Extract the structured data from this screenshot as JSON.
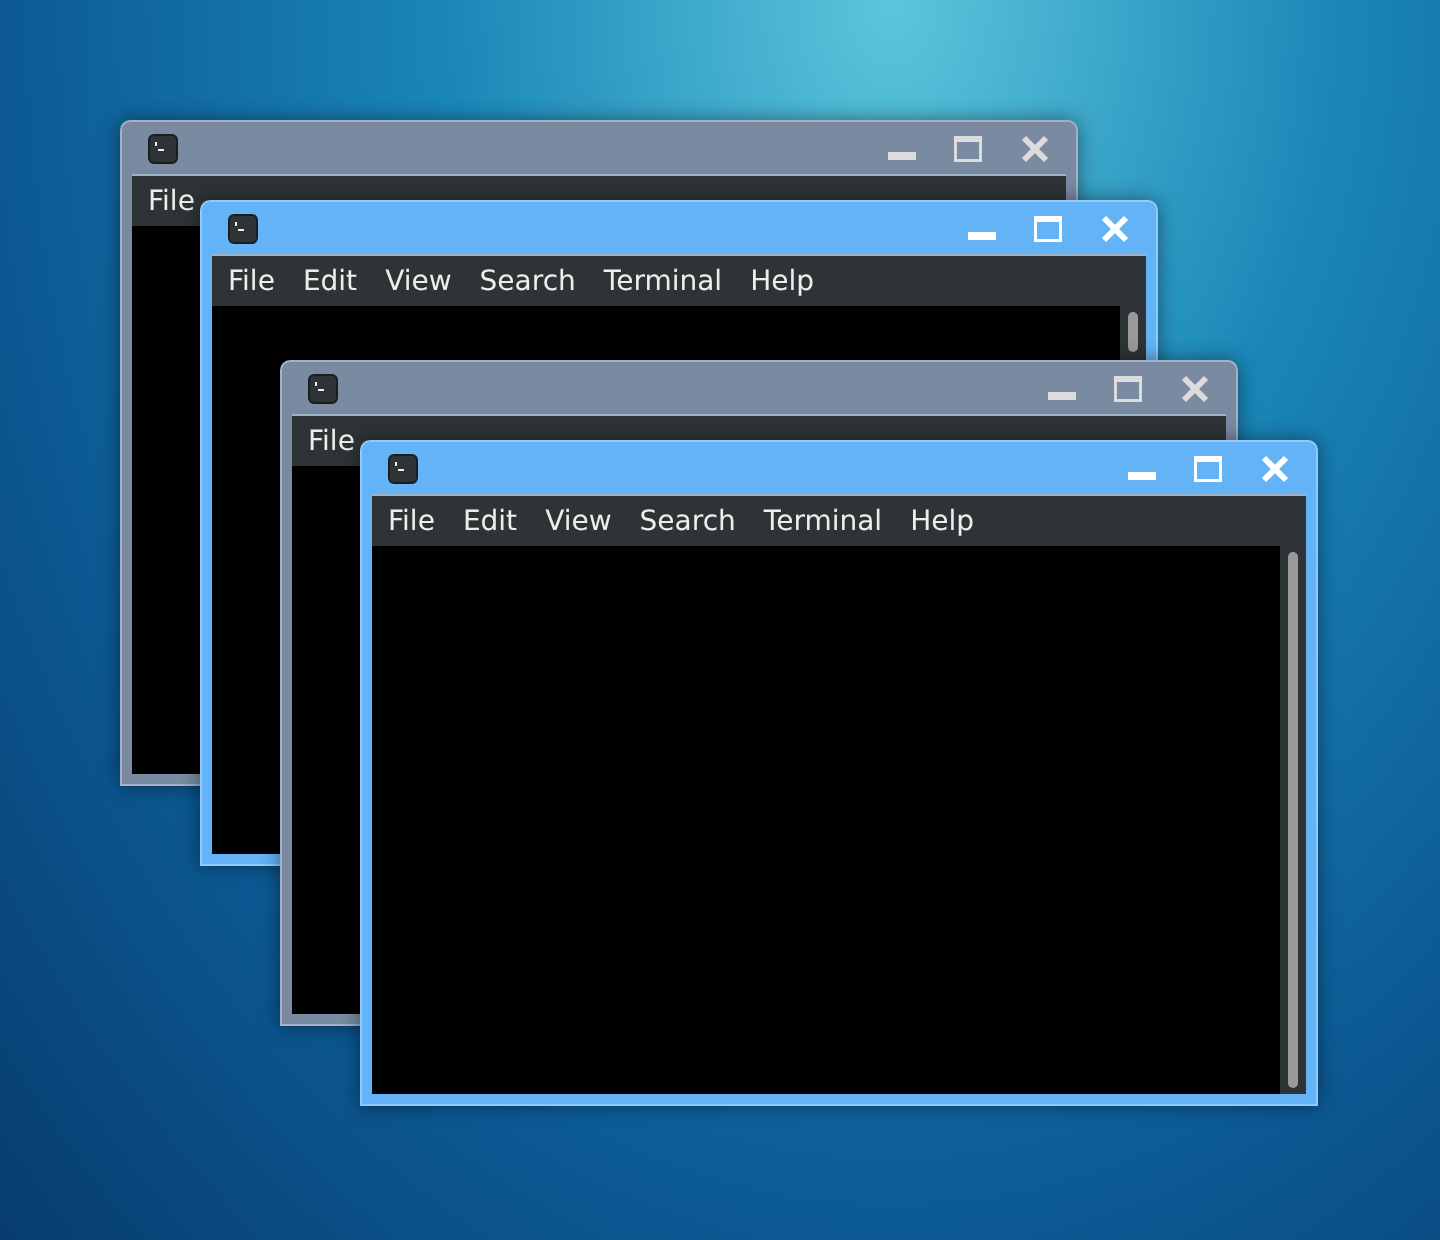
{
  "windows": [
    {
      "active": false,
      "menu": [
        "File"
      ]
    },
    {
      "active": true,
      "menu": [
        "File",
        "Edit",
        "View",
        "Search",
        "Terminal",
        "Help"
      ]
    },
    {
      "active": false,
      "menu": [
        "File"
      ]
    },
    {
      "active": true,
      "menu": [
        "File",
        "Edit",
        "View",
        "Search",
        "Terminal",
        "Help"
      ]
    }
  ]
}
